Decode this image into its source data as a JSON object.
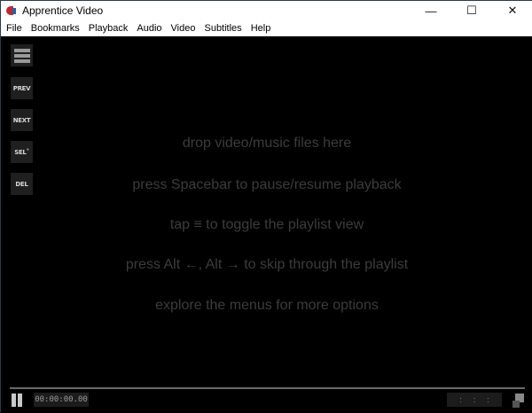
{
  "window": {
    "title": "Apprentice Video",
    "minimize": "—",
    "maximize": "☐",
    "close": "✕"
  },
  "menu": [
    "File",
    "Bookmarks",
    "Playback",
    "Audio",
    "Video",
    "Subtitles",
    "Help"
  ],
  "sidebar": {
    "playlist_icon": "hamburger-icon",
    "prev": "PREV",
    "next": "NEXT",
    "sel": "SEL˚",
    "del": "DEL"
  },
  "hints": [
    "drop video/music files here",
    "press Spacebar to pause/resume playback",
    "tap ≡ to toggle the playlist view",
    "press Alt ←, Alt → to skip through the playlist",
    "explore the menus for more options"
  ],
  "controls": {
    "time": "00:00:00.00",
    "speed": [
      ":",
      ":",
      ":"
    ]
  }
}
